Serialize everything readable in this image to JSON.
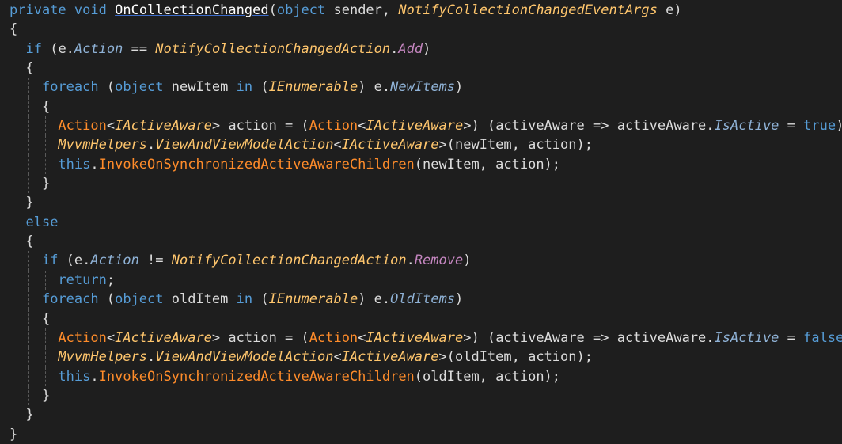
{
  "editor": {
    "lines": [
      [
        {
          "t": "private",
          "c": "kw"
        },
        {
          "t": " ",
          "c": "plain"
        },
        {
          "t": "void",
          "c": "kw"
        },
        {
          "t": " ",
          "c": "plain"
        },
        {
          "t": "OnCollectionChanged",
          "c": "method"
        },
        {
          "t": "(",
          "c": "punc"
        },
        {
          "t": "object",
          "c": "kw"
        },
        {
          "t": " sender, ",
          "c": "plain"
        },
        {
          "t": "NotifyCollectionChangedEventArgs",
          "c": "type"
        },
        {
          "t": " e)",
          "c": "plain"
        }
      ],
      [
        {
          "t": "{",
          "c": "punc"
        }
      ],
      [
        {
          "t": "  ",
          "c": "plain"
        },
        {
          "t": "if",
          "c": "kw"
        },
        {
          "t": " (e.",
          "c": "plain"
        },
        {
          "t": "Action",
          "c": "prop"
        },
        {
          "t": " == ",
          "c": "plain"
        },
        {
          "t": "NotifyCollectionChangedAction",
          "c": "type"
        },
        {
          "t": ".",
          "c": "plain"
        },
        {
          "t": "Add",
          "c": "enum"
        },
        {
          "t": ")",
          "c": "plain"
        }
      ],
      [
        {
          "t": "  {",
          "c": "punc"
        }
      ],
      [
        {
          "t": "    ",
          "c": "plain"
        },
        {
          "t": "foreach",
          "c": "kw"
        },
        {
          "t": " (",
          "c": "plain"
        },
        {
          "t": "object",
          "c": "kw"
        },
        {
          "t": " newItem ",
          "c": "plain"
        },
        {
          "t": "in",
          "c": "kw"
        },
        {
          "t": " (",
          "c": "plain"
        },
        {
          "t": "IEnumerable",
          "c": "iface"
        },
        {
          "t": ") e.",
          "c": "plain"
        },
        {
          "t": "NewItems",
          "c": "prop"
        },
        {
          "t": ")",
          "c": "plain"
        }
      ],
      [
        {
          "t": "    {",
          "c": "punc"
        }
      ],
      [
        {
          "t": "      ",
          "c": "plain"
        },
        {
          "t": "Action",
          "c": "func"
        },
        {
          "t": "<",
          "c": "plain"
        },
        {
          "t": "IActiveAware",
          "c": "iface"
        },
        {
          "t": "> action = (",
          "c": "plain"
        },
        {
          "t": "Action",
          "c": "func"
        },
        {
          "t": "<",
          "c": "plain"
        },
        {
          "t": "IActiveAware",
          "c": "iface"
        },
        {
          "t": ">) (activeAware => activeAware.",
          "c": "plain"
        },
        {
          "t": "IsActive",
          "c": "prop"
        },
        {
          "t": " = ",
          "c": "plain"
        },
        {
          "t": "true",
          "c": "kw"
        },
        {
          "t": ");",
          "c": "plain"
        }
      ],
      [
        {
          "t": "      ",
          "c": "plain"
        },
        {
          "t": "MvvmHelpers",
          "c": "type"
        },
        {
          "t": ".",
          "c": "plain"
        },
        {
          "t": "ViewAndViewModelAction",
          "c": "type"
        },
        {
          "t": "<",
          "c": "plain"
        },
        {
          "t": "IActiveAware",
          "c": "iface"
        },
        {
          "t": ">(newItem, action);",
          "c": "plain"
        }
      ],
      [
        {
          "t": "      ",
          "c": "plain"
        },
        {
          "t": "this",
          "c": "kw"
        },
        {
          "t": ".",
          "c": "plain"
        },
        {
          "t": "InvokeOnSynchronizedActiveAwareChildren",
          "c": "func"
        },
        {
          "t": "(newItem, action);",
          "c": "plain"
        }
      ],
      [
        {
          "t": "    }",
          "c": "punc"
        }
      ],
      [
        {
          "t": "  }",
          "c": "punc"
        }
      ],
      [
        {
          "t": "  ",
          "c": "plain"
        },
        {
          "t": "else",
          "c": "kw"
        }
      ],
      [
        {
          "t": "  {",
          "c": "punc"
        }
      ],
      [
        {
          "t": "    ",
          "c": "plain"
        },
        {
          "t": "if",
          "c": "kw"
        },
        {
          "t": " (e.",
          "c": "plain"
        },
        {
          "t": "Action",
          "c": "prop"
        },
        {
          "t": " != ",
          "c": "plain"
        },
        {
          "t": "NotifyCollectionChangedAction",
          "c": "type"
        },
        {
          "t": ".",
          "c": "plain"
        },
        {
          "t": "Remove",
          "c": "enum"
        },
        {
          "t": ")",
          "c": "plain"
        }
      ],
      [
        {
          "t": "      ",
          "c": "plain"
        },
        {
          "t": "return",
          "c": "kw"
        },
        {
          "t": ";",
          "c": "plain"
        }
      ],
      [
        {
          "t": "    ",
          "c": "plain"
        },
        {
          "t": "foreach",
          "c": "kw"
        },
        {
          "t": " (",
          "c": "plain"
        },
        {
          "t": "object",
          "c": "kw"
        },
        {
          "t": " oldItem ",
          "c": "plain"
        },
        {
          "t": "in",
          "c": "kw"
        },
        {
          "t": " (",
          "c": "plain"
        },
        {
          "t": "IEnumerable",
          "c": "iface"
        },
        {
          "t": ") e.",
          "c": "plain"
        },
        {
          "t": "OldItems",
          "c": "prop"
        },
        {
          "t": ")",
          "c": "plain"
        }
      ],
      [
        {
          "t": "    {",
          "c": "punc"
        }
      ],
      [
        {
          "t": "      ",
          "c": "plain"
        },
        {
          "t": "Action",
          "c": "func"
        },
        {
          "t": "<",
          "c": "plain"
        },
        {
          "t": "IActiveAware",
          "c": "iface"
        },
        {
          "t": "> action = (",
          "c": "plain"
        },
        {
          "t": "Action",
          "c": "func"
        },
        {
          "t": "<",
          "c": "plain"
        },
        {
          "t": "IActiveAware",
          "c": "iface"
        },
        {
          "t": ">) (activeAware => activeAware.",
          "c": "plain"
        },
        {
          "t": "IsActive",
          "c": "prop"
        },
        {
          "t": " = ",
          "c": "plain"
        },
        {
          "t": "false",
          "c": "kw"
        },
        {
          "t": ");",
          "c": "plain"
        }
      ],
      [
        {
          "t": "      ",
          "c": "plain"
        },
        {
          "t": "MvvmHelpers",
          "c": "type"
        },
        {
          "t": ".",
          "c": "plain"
        },
        {
          "t": "ViewAndViewModelAction",
          "c": "type"
        },
        {
          "t": "<",
          "c": "plain"
        },
        {
          "t": "IActiveAware",
          "c": "iface"
        },
        {
          "t": ">(oldItem, action);",
          "c": "plain"
        }
      ],
      [
        {
          "t": "      ",
          "c": "plain"
        },
        {
          "t": "this",
          "c": "kw"
        },
        {
          "t": ".",
          "c": "plain"
        },
        {
          "t": "InvokeOnSynchronizedActiveAwareChildren",
          "c": "func"
        },
        {
          "t": "(oldItem, action);",
          "c": "plain"
        }
      ],
      [
        {
          "t": "    }",
          "c": "punc"
        }
      ],
      [
        {
          "t": "  }",
          "c": "punc"
        }
      ],
      [
        {
          "t": "}",
          "c": "punc"
        }
      ]
    ],
    "colors": {
      "background": "#1e1e1e",
      "keyword": "#569cd6",
      "type": "#ffc66d",
      "method_call": "#ff8c2a",
      "property": "#8fb2d6",
      "enum_member": "#c586c0",
      "plain": "#dcdcdc",
      "indent_guide": "#5a5a5a"
    }
  }
}
